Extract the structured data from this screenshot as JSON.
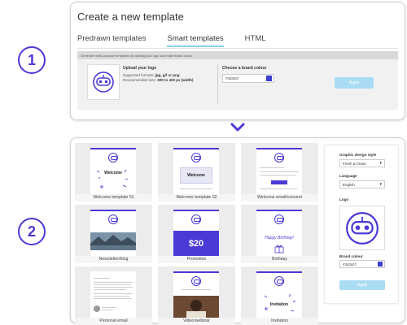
{
  "steps": {
    "one": "1",
    "two": "2"
  },
  "panel1": {
    "title": "Create a new template",
    "tabs": [
      {
        "label": "Predrawn templates",
        "active": false
      },
      {
        "label": "Smart templates",
        "active": true
      },
      {
        "label": "HTML",
        "active": false
      }
    ],
    "info_bar": "Generate multi-purpose templates by adding your logo and main brand colour.",
    "upload": {
      "title": "Upload your logo",
      "formats_label": "Supported formats: ",
      "formats_value": "jpg, gif or png",
      "size_label": "Recommended size: ",
      "size_value": "300 to 400 px (width)"
    },
    "brand_colour": {
      "title": "Choose a brand colour",
      "value": "#3d3dcf"
    },
    "apply_label": "Apply"
  },
  "templates": [
    {
      "label": "Welcome template 01"
    },
    {
      "label": "Welcome template 02"
    },
    {
      "label": "Welcome email/consent"
    },
    {
      "label": "Newsletter/blog"
    },
    {
      "label": "Promotion"
    },
    {
      "label": "Birthday"
    },
    {
      "label": "Personal email"
    },
    {
      "label": "Video/webinar"
    },
    {
      "label": "Invitation"
    }
  ],
  "thumb_text": {
    "welcome1": "Welcome",
    "welcome2": "Welcome",
    "promo": "$20",
    "birthday": "Happy Birthday!",
    "invitation": "Invitation"
  },
  "sidebar": {
    "style_label": "Graphic design style",
    "style_value": "Fresh & Clean",
    "language_label": "Language",
    "language_value": "English",
    "logo_label": "Logo",
    "colour_label": "Brand colour",
    "colour_value": "#3d3dcf",
    "apply_label": "Apply"
  },
  "colors": {
    "accent": "#4b3ad6",
    "apply": "#a9dcf2",
    "swatch": "#3d3dcf"
  }
}
